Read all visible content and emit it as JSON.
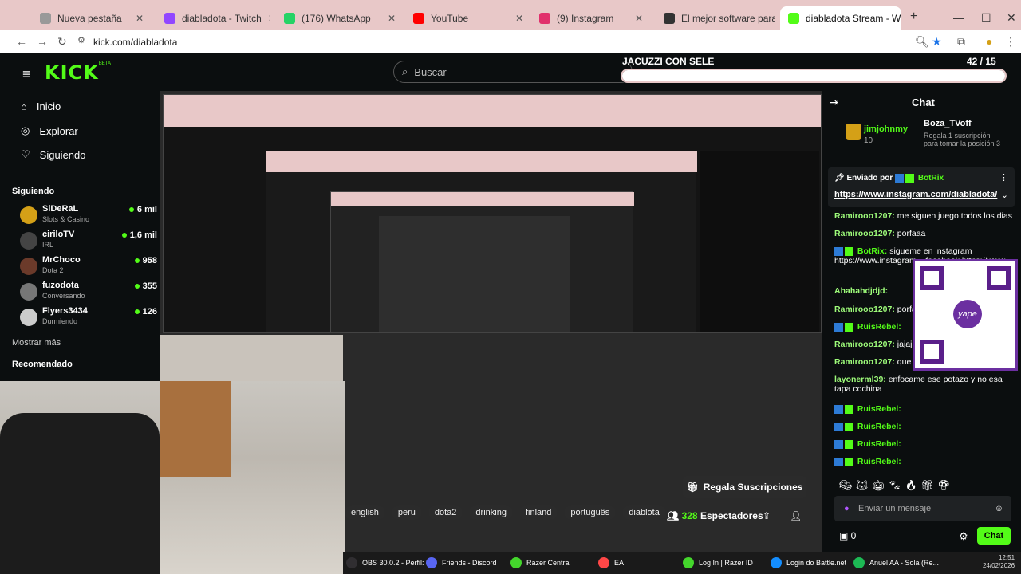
{
  "browser": {
    "tabs": [
      {
        "label": "Nueva pestaña",
        "fav": "#999999"
      },
      {
        "label": "diabladota - Twitch",
        "fav": "#9146ff"
      },
      {
        "label": "(176) WhatsApp",
        "fav": "#25d366"
      },
      {
        "label": "YouTube",
        "fav": "#ff0000"
      },
      {
        "label": "(9) Instagram",
        "fav": "#e1306c"
      },
      {
        "label": "El mejor software para potenc",
        "fav": "#333333"
      },
      {
        "label": "diabladota Stream - Watch Liv",
        "fav": "#53fc18"
      }
    ],
    "url": "kick.com/diabladota"
  },
  "kick": {
    "logo": "KICK",
    "beta": "BETA",
    "search_placeholder": "Buscar",
    "nav": [
      {
        "label": "Inicio",
        "icon": "home-icon"
      },
      {
        "label": "Explorar",
        "icon": "compass-icon"
      },
      {
        "label": "Siguiendo",
        "icon": "heart-icon"
      }
    ],
    "following_header": "Siguiendo",
    "following": [
      {
        "name": "SiDeRaL",
        "category": "Slots & Casino",
        "viewers": "6 mil",
        "color": "#d4a017"
      },
      {
        "name": "ciriloTV",
        "category": "IRL",
        "viewers": "1,6 mil",
        "color": "#444444"
      },
      {
        "name": "MrChoco",
        "category": "Dota 2",
        "viewers": "958",
        "color": "#6b3a2a"
      },
      {
        "name": "fuzodota",
        "category": "Conversando",
        "viewers": "355",
        "color": "#777777"
      },
      {
        "name": "Flyers3434",
        "category": "Durmiendo",
        "viewers": "126",
        "color": "#cccccc"
      }
    ],
    "show_more": "Mostrar más",
    "recommended_header": "Recomendado"
  },
  "stream": {
    "overlay_title": "JACUZZI CON SELE",
    "goal": "42 / 15",
    "goal_fraction": 1.0,
    "tags": [
      "english",
      "peru",
      "dota2",
      "drinking",
      "finland",
      "português",
      "diablota"
    ],
    "gift_button": "Regala Suscripciones",
    "viewers_count": "328",
    "viewers_label": "Espectadores"
  },
  "chat": {
    "header": "Chat",
    "gift_user": "jimjohnmy",
    "gift_count": "10",
    "gift_target": "Boza_TVoff",
    "gift_text": "Regala 1 suscripción para tomar la posición 3",
    "pinned_by": "Enviado por",
    "pinned_bot": "BotRix",
    "pinned_link": "https://www.instagram.com/diabladota/",
    "messages": [
      {
        "user": "Ramirooo1207:",
        "text": "me siguen juego todos los dias"
      },
      {
        "user": "Ramirooo1207:",
        "text": "porfaaa"
      },
      {
        "user": "BotRix:",
        "text": "sigueme en instagram https://www.instagram... facebook https://www..."
      },
      {
        "user": "Ahahahdjdjd:",
        "text": ""
      },
      {
        "user": "Ramirooo1207:",
        "text": "porfa"
      },
      {
        "user": "RuisRebel:",
        "text": ""
      },
      {
        "user": "Ramirooo1207:",
        "text": "jajaja"
      },
      {
        "user": "Ramirooo1207:",
        "text": "que li"
      },
      {
        "user": "layonerml39:",
        "text": "enfocame ese potazo y no esa tapa cochina"
      },
      {
        "user": "RuisRebel:",
        "text": ""
      },
      {
        "user": "RuisRebel:",
        "text": ""
      },
      {
        "user": "RuisRebel:",
        "text": ""
      },
      {
        "user": "RuisRebel:",
        "text": ""
      }
    ],
    "qr_label": "yape",
    "input_placeholder": "Enviar un mensaje",
    "points": "0",
    "send_label": "Chat"
  },
  "taskbar": {
    "items": [
      {
        "label": "OBS 30.0.2 - Perfil: ...",
        "color": "#302e31"
      },
      {
        "label": "Friends - Discord",
        "color": "#5865f2"
      },
      {
        "label": "Razer Central",
        "color": "#44d62c"
      },
      {
        "label": "EA",
        "color": "#ff4747"
      },
      {
        "label": "Log In | Razer ID",
        "color": "#44d62c"
      },
      {
        "label": "Login do Battle.net",
        "color": "#148eff"
      },
      {
        "label": "Anuel AA - Sola (Re...",
        "color": "#1db954"
      }
    ],
    "time": "12:51",
    "date": "24/02/2026"
  }
}
